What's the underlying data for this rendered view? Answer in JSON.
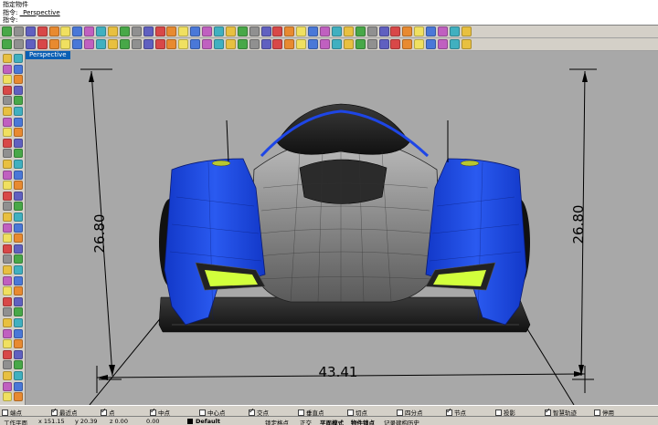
{
  "command": {
    "line1": "指定物件",
    "line2_prefix": "指令: ",
    "line2_value": "_Perspective",
    "line3": "指令:"
  },
  "toolbar_top": {
    "icons": [
      "new",
      "open",
      "save",
      "print",
      "import",
      "cut",
      "copy",
      "paste",
      "undo",
      "redo",
      "move",
      "select",
      "pan",
      "rotate",
      "zoom",
      "zoom-window",
      "zoom-extents",
      "four-view",
      "grid",
      "osnap",
      "ortho",
      "planar",
      "layer",
      "properties",
      "render",
      "light",
      "material",
      "texture",
      "hide",
      "show",
      "lock",
      "unlock",
      "group",
      "ungroup",
      "block",
      "measure",
      "dimension",
      "text",
      "help",
      "options"
    ]
  },
  "toolbar_second": {
    "icons": [
      "point",
      "curve",
      "line",
      "polyline",
      "arc",
      "circle",
      "ellipse",
      "rectangle",
      "polygon",
      "freeform",
      "offset",
      "fillet",
      "chamfer",
      "extend",
      "trim",
      "split",
      "join",
      "explode",
      "surface",
      "extrude",
      "loft",
      "sweep",
      "revolve",
      "network",
      "patch",
      "solid",
      "box",
      "sphere",
      "cylinder",
      "cone",
      "torus",
      "boolean",
      "shell",
      "mesh",
      "render-preview",
      "analyze",
      "curvature",
      "zebra",
      "draft",
      "environment"
    ]
  },
  "viewport": {
    "tab_label": "Perspective",
    "dim_left": "26.80",
    "dim_right": "26.80",
    "dim_bottom": "43.41"
  },
  "osnap": [
    {
      "label": "端点",
      "checked": false
    },
    {
      "label": "最近点",
      "checked": true
    },
    {
      "label": "点",
      "checked": true
    },
    {
      "label": "中点",
      "checked": true
    },
    {
      "label": "中心点",
      "checked": false
    },
    {
      "label": "交点",
      "checked": true
    },
    {
      "label": "垂直点",
      "checked": false
    },
    {
      "label": "切点",
      "checked": false
    },
    {
      "label": "四分点",
      "checked": false
    },
    {
      "label": "节点",
      "checked": true
    },
    {
      "label": "投影",
      "checked": false
    },
    {
      "label": "智慧轨迹",
      "checked": true
    },
    {
      "label": "停用",
      "checked": false
    }
  ],
  "status": {
    "cplane": "工作平面",
    "x": "x 151.15",
    "y": "y 20.39",
    "z": "z 0.00",
    "units": "0.00",
    "layer": "Default",
    "lock_grid": "锁定格点",
    "ortho": "正交",
    "planar": "平面模式",
    "osnap": "物件锁点",
    "history": "记录建构历史"
  },
  "colors": {
    "accent_blue": "#0a5fb4",
    "car_blue": "#1e46e6",
    "light_green": "#d2ff3c",
    "viewport_bg": "#a8a8a8"
  }
}
